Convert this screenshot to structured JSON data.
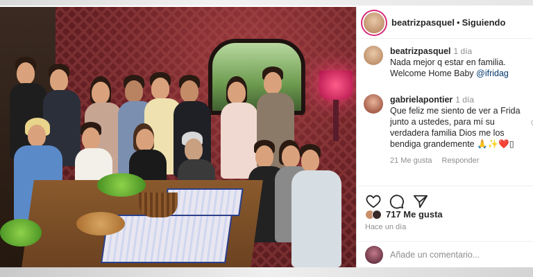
{
  "post": {
    "author": "beatrizpasquel",
    "follow_status": "Siguiendo",
    "separator": "•"
  },
  "comments": [
    {
      "user": "beatrizpasquel",
      "time": "1 día",
      "text": "Nada mejor q estar en familia. Welcome Home Baby ",
      "mention": "@ifridag"
    },
    {
      "user": "gabrielapontier",
      "time": "1 día",
      "text": "Que feliz me siento de ver a Frida junto a ustedes, para mí su verdadera familia Dios me los bendiga grandemente 🙏✨❤️▯",
      "likes": "21 Me gusta",
      "reply": "Responder"
    }
  ],
  "actions": {
    "like_icon": "heart-icon",
    "comment_icon": "comment-icon",
    "share_icon": "share-icon",
    "likes_count": "717 Me gusta",
    "time_ago": "Hace un día"
  },
  "add_comment": {
    "placeholder": "Añade un comentario..."
  },
  "colors": {
    "story_ring": "#d62976",
    "mention": "#00376b",
    "muted": "#8e8e8e"
  }
}
